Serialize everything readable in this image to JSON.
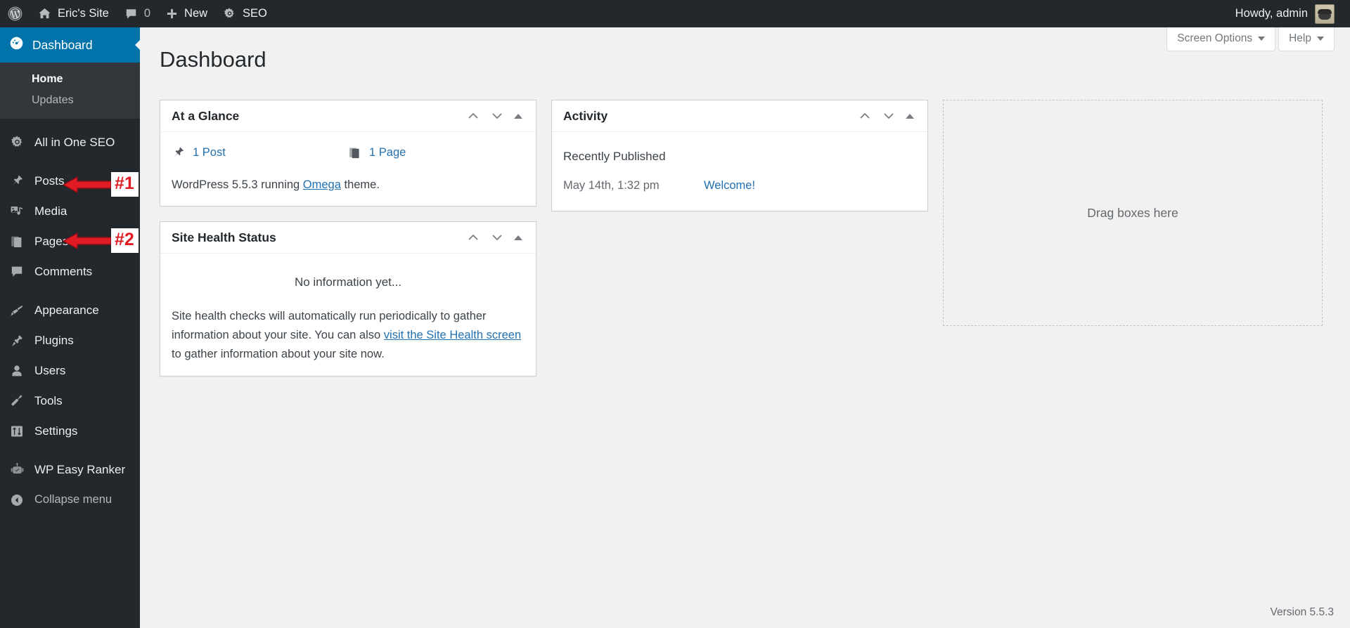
{
  "colors": {
    "adminbar_bg": "#23282d",
    "sidebar_bg": "#23282d",
    "submenu_bg": "#32373c",
    "accent_blue": "#0073aa",
    "link_blue": "#2271b1",
    "content_bg": "#f1f1f1",
    "annotation_red": "#e01b24"
  },
  "adminbar": {
    "wp_logo_icon": "wordpress-logo-icon",
    "site_icon": "home-icon",
    "site_name": "Eric's Site",
    "comments_icon": "comment-bubble-icon",
    "comments_count": "0",
    "new_icon": "plus-icon",
    "new_label": "New",
    "seo_icon": "gear-icon",
    "seo_label": "SEO",
    "howdy": "Howdy, admin",
    "avatar": "avatar"
  },
  "sidebar": {
    "current": {
      "icon": "dashboard-icon",
      "label": "Dashboard"
    },
    "submenu": [
      {
        "label": "Home",
        "current": true
      },
      {
        "label": "Updates",
        "current": false
      }
    ],
    "items": [
      {
        "label": "All in One SEO",
        "icon": "aioseo-gear-icon"
      },
      {
        "label": "Posts",
        "icon": "pin-icon"
      },
      {
        "label": "Media",
        "icon": "media-icon"
      },
      {
        "label": "Pages",
        "icon": "pages-icon"
      },
      {
        "label": "Comments",
        "icon": "comment-bubble-icon"
      },
      {
        "label": "Appearance",
        "icon": "paintbrush-icon"
      },
      {
        "label": "Plugins",
        "icon": "plug-icon"
      },
      {
        "label": "Users",
        "icon": "user-icon"
      },
      {
        "label": "Tools",
        "icon": "wrench-icon"
      },
      {
        "label": "Settings",
        "icon": "sliders-icon"
      },
      {
        "label": "WP Easy Ranker",
        "icon": "robot-icon"
      },
      {
        "label": "Collapse menu",
        "icon": "collapse-arrow-icon"
      }
    ]
  },
  "annotations": [
    {
      "tag": "#1",
      "target": "Posts",
      "icon": "left-arrow-icon"
    },
    {
      "tag": "#2",
      "target": "Pages",
      "icon": "left-arrow-icon"
    }
  ],
  "screen_meta": {
    "screen_options": "Screen Options",
    "help": "Help",
    "caret_icon": "chevron-down-icon"
  },
  "page": {
    "title": "Dashboard",
    "footer_version": "Version 5.5.3"
  },
  "widgets": {
    "at_a_glance": {
      "title": "At a Glance",
      "actions": {
        "up": "chevron-up-icon",
        "down": "chevron-down-icon",
        "toggle": "triangle-up-icon"
      },
      "counts": [
        {
          "icon": "pin-icon",
          "label": "1 Post"
        },
        {
          "icon": "pages-icon",
          "label": "1 Page"
        }
      ],
      "version_prefix": "WordPress 5.5.3 running ",
      "theme_link": "Omega",
      "version_suffix": " theme."
    },
    "site_health": {
      "title": "Site Health Status",
      "actions": {
        "up": "chevron-up-icon",
        "down": "chevron-down-icon",
        "toggle": "triangle-up-icon"
      },
      "status": "No information yet...",
      "text_before": "Site health checks will automatically run periodically to gather information about your site. You can also ",
      "link": "visit the Site Health screen",
      "text_after": " to gather information about your site now."
    },
    "activity": {
      "title": "Activity",
      "actions": {
        "up": "chevron-up-icon",
        "down": "chevron-down-icon",
        "toggle": "triangle-up-icon"
      },
      "subtitle": "Recently Published",
      "rows": [
        {
          "time": "May 14th, 1:32 pm",
          "title": "Welcome!"
        }
      ]
    },
    "dropzone": {
      "label": "Drag boxes here"
    }
  }
}
